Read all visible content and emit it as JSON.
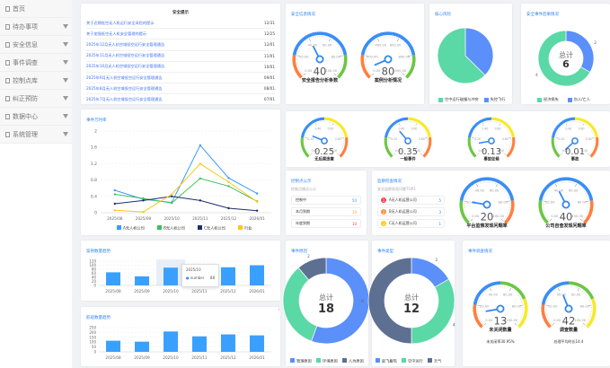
{
  "colors": {
    "blue": "#5b8ff9",
    "green": "#5ad8a6",
    "dark": "#5d7092",
    "accent": "#2f86f6",
    "orange": "#ff7f3f",
    "yellow": "#f7e928",
    "gaugeGreen": "#6cc644",
    "gaugeBlue": "#3a8ef6"
  },
  "sidebar": {
    "items": [
      {
        "label": "首页",
        "arrow": false
      },
      {
        "label": "待办事项",
        "arrow": true
      },
      {
        "label": "安全信息",
        "arrow": true
      },
      {
        "label": "事件调查",
        "arrow": true
      },
      {
        "label": "控制点库",
        "arrow": true
      },
      {
        "label": "纠正预防",
        "arrow": true
      },
      {
        "label": "数据中心",
        "arrow": true
      },
      {
        "label": "系统管理",
        "arrow": true
      }
    ]
  },
  "notices": {
    "title": "安全提示",
    "items": [
      {
        "text": "关于近期低空无人机运行安全风险的提示",
        "date": "12/31"
      },
      {
        "text": "关于加强低空无人机安全管理的提示",
        "date": "12/25"
      },
      {
        "text": "2025年12月无人机空域低空运行安全管理通告",
        "date": "12/01"
      },
      {
        "text": "2025年11月无人机空域低空运行安全管理通告",
        "date": "11/01"
      },
      {
        "text": "2025年10月无人机空域低空运行安全管理通告",
        "date": "10/01"
      },
      {
        "text": "2025年9月无人机空域低空运行安全管理通告",
        "date": "09/01"
      },
      {
        "text": "2025年8月无人机空域低空运行安全管理通告",
        "date": "08/01"
      },
      {
        "text": "2025年7月无人机空域低空运行安全管理通告",
        "date": "07/01"
      }
    ]
  },
  "safety_info": {
    "title": "安全信息情况",
    "gauges": [
      {
        "label": "安全报告分析条数",
        "value": 40,
        "max": 100,
        "bands": [
          [
            0.2,
            "#ff7f3f"
          ],
          [
            0.8,
            "#3a8ef6"
          ],
          [
            1,
            "#6cc644"
          ]
        ]
      },
      {
        "label": "案例分析情况",
        "value": 80,
        "max": 1000,
        "bands": [
          [
            0.2,
            "#ff7f3f"
          ],
          [
            0.8,
            "#3a8ef6"
          ],
          [
            1,
            "#6cc644"
          ]
        ]
      }
    ]
  },
  "core_risk": {
    "title": "核心风险",
    "chart_data": {
      "type": "pie",
      "categories": [
        "失控飞行",
        "空中运行碰撞与冲突"
      ],
      "values": [
        3,
        5
      ],
      "colors": [
        "#5b8ff9",
        "#5ad8a6"
      ]
    },
    "legend": [
      "空中运行碰撞与冲突",
      "失控飞行"
    ]
  },
  "consequence": {
    "title": "安全事件后果情况",
    "total_label": "总计",
    "total": "6",
    "chart_data": {
      "type": "pie",
      "categories": [
        "伤人/亡人",
        "经济损失"
      ],
      "values": [
        2,
        4
      ],
      "colors": [
        "#5b8ff9",
        "#5ad8a6"
      ]
    },
    "legend": [
      "经济损失",
      "伤人/亡人"
    ],
    "value_labels": [
      "2",
      "4"
    ]
  },
  "line_chart": {
    "title": "事件万时率",
    "chart_data": {
      "type": "line",
      "categories": [
        "2025/08",
        "2025/09",
        "2025/10",
        "2025/11",
        "2025/12",
        "2026/01"
      ],
      "ylim": [
        0,
        2
      ],
      "yticks": [
        "0",
        "0.4",
        "0.8",
        "1.2",
        "1.6",
        "2"
      ],
      "grid": true,
      "legend": "bottom",
      "series": [
        {
          "name": "A无人机公司",
          "color": "#3a9bff",
          "values": [
            0.55,
            0.33,
            0.25,
            1.65,
            0.85,
            0.47
          ]
        },
        {
          "name": "B无人机公司",
          "color": "#3cc159",
          "values": [
            0.45,
            0.35,
            0.24,
            0.84,
            0.65,
            0.28
          ]
        },
        {
          "name": "C无人机公司",
          "color": "#1f2d6b",
          "values": [
            0.22,
            0.3,
            0.4,
            0.3,
            0.11,
            0.05
          ]
        },
        {
          "name": "行业",
          "color": "#ffc814",
          "values": [
            0.06,
            0.02,
            0.45,
            1.2,
            0.75,
            0.27
          ]
        }
      ]
    }
  },
  "rate_gauges": [
    {
      "label": "无后果违章",
      "value": 0.25,
      "max": 1,
      "bands": [
        [
          0.2,
          "#6cc644"
        ],
        [
          0.5,
          "#3a8ef6"
        ],
        [
          0.8,
          "#f7e928"
        ],
        [
          1,
          "#ff7f3f"
        ]
      ]
    },
    {
      "label": "一般事件",
      "value": 0.35,
      "max": 1,
      "bands": [
        [
          0.2,
          "#6cc644"
        ],
        [
          0.5,
          "#3a8ef6"
        ],
        [
          0.8,
          "#f7e928"
        ],
        [
          1,
          "#ff7f3f"
        ]
      ]
    },
    {
      "label": "事故征候",
      "value": 0.13,
      "max": 1,
      "bands": [
        [
          0.2,
          "#6cc644"
        ],
        [
          0.5,
          "#3a8ef6"
        ],
        [
          0.8,
          "#f7e928"
        ],
        [
          1,
          "#ff7f3f"
        ]
      ]
    },
    {
      "label": "事故",
      "value": 0.01,
      "max": 1,
      "bands": [
        [
          0.2,
          "#6cc644"
        ],
        [
          0.5,
          "#3a8ef6"
        ],
        [
          0.8,
          "#f7e928"
        ],
        [
          1,
          "#ff7f3f"
        ]
      ]
    }
  ],
  "control_points": {
    "title": "控制点公示",
    "subtitle": "控制点情况公示",
    "rows": [
      {
        "label": "控制中",
        "value": "50",
        "color": "#3a9bff"
      },
      {
        "label": "本月到期",
        "value": "10",
        "color": "#ff9a3c"
      },
      {
        "label": "年度到期",
        "value": "10",
        "color": "#f5424e"
      }
    ]
  },
  "inspection": {
    "title": "监察检查情况",
    "subtitle": "安全监察发现问题TOP3",
    "top": [
      {
        "rank": "1",
        "name": "A无人机运营公司",
        "value": "5",
        "color": "#f5424e"
      },
      {
        "rank": "2",
        "name": "B无人机运营公司",
        "value": "3",
        "color": "#ff8a3c"
      },
      {
        "rank": "3",
        "name": "C无人机运营公司",
        "value": "1",
        "color": "#ffc814"
      }
    ],
    "gauges": [
      {
        "label": "平台监察发现问题率",
        "value": 20,
        "max": 100,
        "bands": [
          [
            0.2,
            "#6cc644"
          ],
          [
            0.8,
            "#3a8ef6"
          ],
          [
            1,
            "#ff7f3f"
          ]
        ]
      },
      {
        "label": "公司自查发现问题率",
        "value": 40,
        "max": 100,
        "bands": [
          [
            0.2,
            "#6cc644"
          ],
          [
            0.8,
            "#3a8ef6"
          ],
          [
            1,
            "#ff7f3f"
          ]
        ]
      }
    ]
  },
  "bar1": {
    "title": "案例数量趋势",
    "chart_data": {
      "type": "bar",
      "categories": [
        "2025/08",
        "2025/09",
        "2025/10",
        "2025/11",
        "2025/12",
        "2026/01"
      ],
      "values": [
        65,
        45,
        88,
        40,
        90,
        100
      ],
      "ylim": [
        0,
        120
      ],
      "yticks": [
        "0",
        "20",
        "40",
        "60",
        "80",
        "100",
        "120"
      ]
    },
    "tooltip": {
      "title": "2025/10",
      "series": "number",
      "value": "88"
    }
  },
  "bar2": {
    "title": "航班数量趋势",
    "chart_data": {
      "type": "bar",
      "categories": [
        "2025/08",
        "2025/09",
        "2025/10",
        "2025/11",
        "2025/12",
        "2026/01"
      ],
      "values": [
        115,
        105,
        210,
        160,
        180,
        170
      ],
      "ylim": [
        0,
        250
      ],
      "yticks": [
        "0",
        "50",
        "100",
        "150",
        "200",
        "250"
      ]
    }
  },
  "cause": {
    "title": "事件原因",
    "total_label": "总计",
    "total": "18",
    "chart_data": {
      "type": "pie",
      "categories": [
        "管理原因",
        "环境原因",
        "人为原因"
      ],
      "values": [
        10,
        6,
        2
      ],
      "colors": [
        "#5b8ff9",
        "#5ad8a6",
        "#5d7092"
      ]
    },
    "value_labels": [
      "10",
      "6",
      "2"
    ]
  },
  "etype": {
    "title": "事件类型",
    "total_label": "总计",
    "total": "12",
    "chart_data": {
      "type": "pie",
      "categories": [
        "起飞着陆",
        "空中运行",
        "天气"
      ],
      "values": [
        2,
        4,
        6
      ],
      "colors": [
        "#5b8ff9",
        "#5ad8a6",
        "#5d7092"
      ]
    },
    "value_labels": [
      "2",
      "4",
      "6"
    ]
  },
  "investigation": {
    "title": "事件调查情况",
    "gauges": [
      {
        "label": "未关闭数量",
        "sub": "未关闭率30.95%",
        "value": 13,
        "max": 100,
        "bands": [
          [
            0.2,
            "#ff7f3f"
          ],
          [
            0.5,
            "#3a8ef6"
          ],
          [
            0.75,
            "#6cc644"
          ],
          [
            1,
            "#f7e928"
          ]
        ]
      },
      {
        "label": "调查数量",
        "sub": "处理平均时长14.4",
        "value": 42,
        "max": 100,
        "bands": [
          [
            0.2,
            "#ff7f3f"
          ],
          [
            0.5,
            "#3a8ef6"
          ],
          [
            0.75,
            "#6cc644"
          ],
          [
            1,
            "#f7e928"
          ]
        ]
      }
    ]
  }
}
